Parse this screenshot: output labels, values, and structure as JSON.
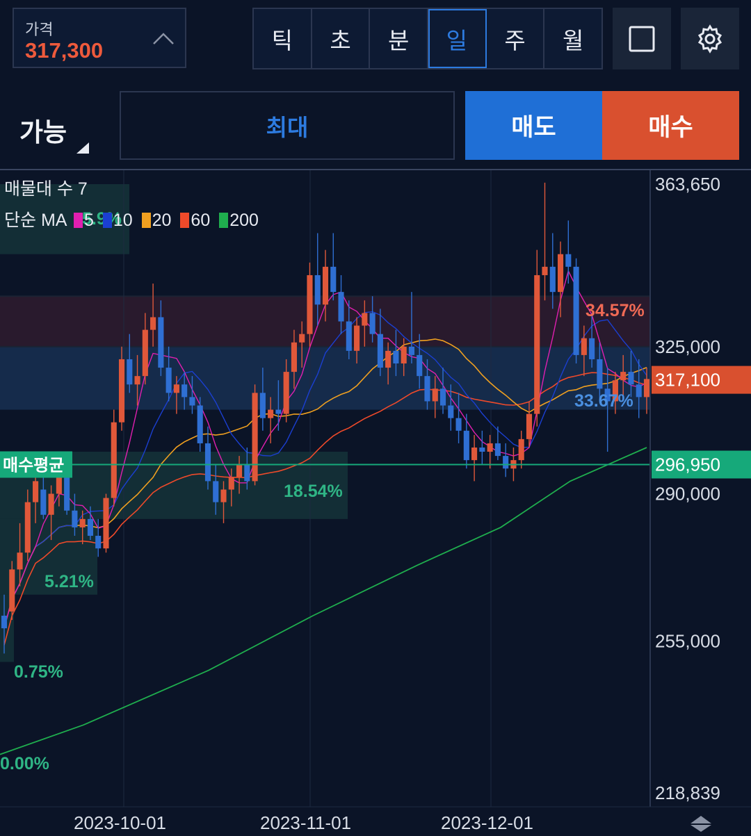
{
  "header": {
    "price_label": "가격",
    "price_value": "317,300",
    "period_tabs": [
      {
        "label": "틱",
        "active": false
      },
      {
        "label": "초",
        "active": false
      },
      {
        "label": "분",
        "active": false
      },
      {
        "label": "일",
        "active": true
      },
      {
        "label": "주",
        "active": false
      },
      {
        "label": "월",
        "active": false
      }
    ],
    "fullscreen_icon": "square-icon",
    "settings_icon": "gear-icon"
  },
  "order": {
    "available_label": "가능",
    "max_label": "최대",
    "sell_label": "매도",
    "buy_label": "매수"
  },
  "colors": {
    "up": "#e0583a",
    "down": "#2f6fd3",
    "ma5": "#e11fb0",
    "ma10": "#1b3fd1",
    "ma20": "#f0a020",
    "ma60": "#ef4a2a",
    "ma200": "#1fae4e",
    "avg_price": "#16a97a"
  },
  "legend": {
    "volume_profile": "매물대 수 7",
    "ma_type": "단순 MA",
    "ma_periods": [
      "5",
      "10",
      "20",
      "60",
      "200"
    ]
  },
  "chart_data": {
    "type": "candlestick",
    "y_axis_labels": [
      "363,650",
      "325,000",
      "290,000",
      "255,000",
      "218,839"
    ],
    "ylim": [
      218839,
      363650
    ],
    "x_axis_labels": [
      "2023-10-01",
      "2023-11-01",
      "2023-12-01"
    ],
    "current_price_label": "317,100",
    "current_price": 317100,
    "avg_buy_label": "매수평균",
    "avg_buy_price_label": "296,950",
    "avg_buy_price": 296950,
    "volume_profile_pct": [
      "34.57%",
      "33.67%",
      "18.54%",
      "5.21%",
      "0.75%",
      "0.00%",
      "5.9%"
    ],
    "volume_profile_bands": [
      {
        "low": 347000,
        "high": 363650,
        "pct": "5.9%"
      },
      {
        "low": 325000,
        "high": 337000,
        "pct": "34.57%"
      },
      {
        "low": 310000,
        "high": 325000,
        "pct": "33.67%"
      },
      {
        "low": 284000,
        "high": 300000,
        "pct": "18.54%"
      },
      {
        "low": 266000,
        "high": 284000,
        "pct": "5.21%"
      },
      {
        "low": 250000,
        "high": 266000,
        "pct": "0.75%"
      },
      {
        "low": 218839,
        "high": 250000,
        "pct": "0.00%"
      }
    ],
    "candles": [
      [
        261000,
        266000,
        252000,
        258000
      ],
      [
        262000,
        274000,
        260000,
        272000
      ],
      [
        272000,
        283000,
        268000,
        276000
      ],
      [
        276000,
        291000,
        274000,
        288000
      ],
      [
        288000,
        296000,
        283000,
        293000
      ],
      [
        291000,
        298000,
        284000,
        285000
      ],
      [
        285000,
        292000,
        279000,
        290000
      ],
      [
        290000,
        297000,
        287000,
        294000
      ],
      [
        294000,
        295000,
        285000,
        286000
      ],
      [
        286000,
        290000,
        280000,
        282000
      ],
      [
        282000,
        286000,
        278000,
        284000
      ],
      [
        284000,
        287000,
        279000,
        280000
      ],
      [
        280000,
        284000,
        275000,
        277000
      ],
      [
        277000,
        290000,
        276000,
        289000
      ],
      [
        289000,
        310000,
        287000,
        307000
      ],
      [
        307000,
        325000,
        305000,
        322000
      ],
      [
        322000,
        328000,
        314000,
        316000
      ],
      [
        316000,
        323000,
        311000,
        318000
      ],
      [
        318000,
        333000,
        316000,
        329000
      ],
      [
        329000,
        340000,
        325000,
        332000
      ],
      [
        332000,
        336000,
        318000,
        320000
      ],
      [
        320000,
        325000,
        312000,
        314000
      ],
      [
        314000,
        318000,
        309000,
        316000
      ],
      [
        316000,
        319000,
        310000,
        313000
      ],
      [
        313000,
        318000,
        309000,
        311000
      ],
      [
        311000,
        313000,
        300000,
        302000
      ],
      [
        302000,
        306000,
        291000,
        293000
      ],
      [
        293000,
        297000,
        285000,
        288000
      ],
      [
        288000,
        293000,
        283000,
        291000
      ],
      [
        291000,
        296000,
        287000,
        294000
      ],
      [
        294000,
        299000,
        290000,
        297000
      ],
      [
        297000,
        301000,
        291000,
        293000
      ],
      [
        293000,
        316000,
        292000,
        314000
      ],
      [
        314000,
        320000,
        305000,
        308000
      ],
      [
        308000,
        313000,
        302000,
        310000
      ],
      [
        310000,
        317000,
        305000,
        309000
      ],
      [
        309000,
        322000,
        307000,
        319000
      ],
      [
        319000,
        329000,
        315000,
        326000
      ],
      [
        326000,
        331000,
        320000,
        328000
      ],
      [
        328000,
        345000,
        325000,
        342000
      ],
      [
        342000,
        352000,
        330000,
        335000
      ],
      [
        335000,
        348000,
        331000,
        344000
      ],
      [
        344000,
        352000,
        336000,
        338000
      ],
      [
        338000,
        342000,
        328000,
        331000
      ],
      [
        331000,
        336000,
        322000,
        324000
      ],
      [
        324000,
        332000,
        321000,
        330000
      ],
      [
        330000,
        336000,
        325000,
        333000
      ],
      [
        333000,
        337000,
        326000,
        328000
      ],
      [
        328000,
        334000,
        318000,
        320000
      ],
      [
        320000,
        326000,
        316000,
        324000
      ],
      [
        324000,
        329000,
        318000,
        321000
      ],
      [
        321000,
        327000,
        318000,
        325000
      ],
      [
        325000,
        338000,
        321000,
        323000
      ],
      [
        323000,
        328000,
        315000,
        318000
      ],
      [
        318000,
        322000,
        310000,
        312000
      ],
      [
        312000,
        318000,
        308000,
        315000
      ],
      [
        315000,
        320000,
        309000,
        311000
      ],
      [
        311000,
        316000,
        305000,
        308000
      ],
      [
        308000,
        314000,
        302000,
        305000
      ],
      [
        305000,
        309000,
        296000,
        298000
      ],
      [
        298000,
        304000,
        293000,
        301000
      ],
      [
        301000,
        305000,
        297000,
        300000
      ],
      [
        300000,
        304000,
        296000,
        302000
      ],
      [
        302000,
        306000,
        298000,
        299000
      ],
      [
        299000,
        302000,
        294000,
        296000
      ],
      [
        296000,
        301000,
        293000,
        298000
      ],
      [
        298000,
        305000,
        296000,
        303000
      ],
      [
        303000,
        312000,
        301000,
        309000
      ],
      [
        309000,
        348000,
        306000,
        342000
      ],
      [
        342000,
        364000,
        336000,
        344000
      ],
      [
        344000,
        352000,
        334000,
        338000
      ],
      [
        338000,
        350000,
        332000,
        347000
      ],
      [
        347000,
        355000,
        340000,
        344000
      ],
      [
        344000,
        346000,
        321000,
        323000
      ],
      [
        323000,
        330000,
        318000,
        327000
      ],
      [
        327000,
        333000,
        320000,
        322000
      ],
      [
        322000,
        326000,
        312000,
        315000
      ],
      [
        315000,
        320000,
        300000,
        312000
      ],
      [
        312000,
        319000,
        309000,
        317000
      ],
      [
        317000,
        323000,
        313000,
        319000
      ],
      [
        319000,
        324000,
        313000,
        316000
      ],
      [
        316000,
        322000,
        308000,
        313000
      ],
      [
        313000,
        320000,
        309000,
        317300
      ]
    ]
  }
}
